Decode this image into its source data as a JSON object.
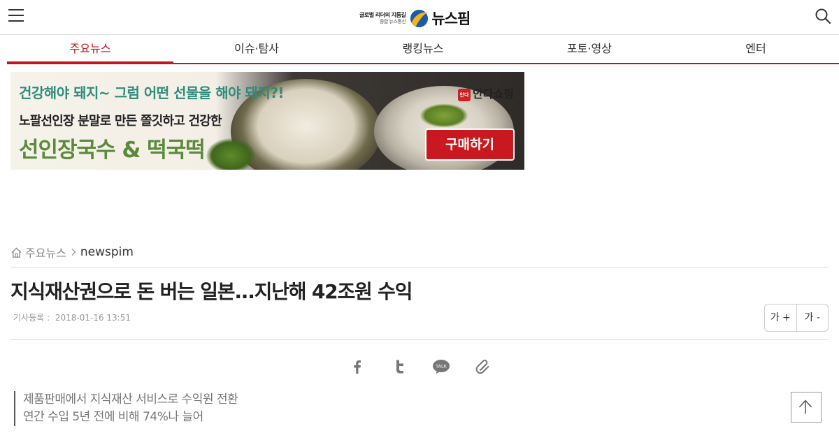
{
  "header": {
    "logo": {
      "slogan_line1": "글로벌 리더의 지름길",
      "slogan_line2": "종합 뉴스통신",
      "name": "뉴스핌"
    },
    "icons": {
      "menu": "hamburger-menu-icon",
      "search": "search-icon"
    }
  },
  "nav": {
    "tabs": [
      {
        "label": "주요뉴스",
        "active": true
      },
      {
        "label": "이슈·탐사",
        "active": false
      },
      {
        "label": "랭킹뉴스",
        "active": false
      },
      {
        "label": "포토·영상",
        "active": false
      },
      {
        "label": "엔터",
        "active": false
      }
    ],
    "accent_color": "#c4151c"
  },
  "ad": {
    "headline": "건강해야 돼지~ 그럼 어떤 선물을 해야 돼지?!",
    "subline": "노팔선인장 분말로 만든 쫄깃하고 건강한",
    "product": "선인장국수 & 떡국떡",
    "brand": "안다쇼핑",
    "brand_stamp": "안다",
    "buy_label": "구매하기"
  },
  "breadcrumb": {
    "home_label": "주요뉴스",
    "current": "newspim"
  },
  "article": {
    "title": "지식재산권으로 돈 버는 일본...지난해 42조원 수익",
    "meta_label": "기사등록 :",
    "date": "2018-01-16 13:51",
    "font_increase": "가 +",
    "font_decrease": "가 -",
    "summary": [
      "제품판매에서 지식재산 서비스로 수익원 전환",
      "연간 수입 5년 전에 비해 74%나 늘어"
    ]
  },
  "share": {
    "icons": [
      "facebook-icon",
      "twitter-icon",
      "kakaotalk-icon",
      "link-clip-icon"
    ],
    "kakao_text": "TALK"
  },
  "scroll_top_icon": "arrow-up-icon"
}
